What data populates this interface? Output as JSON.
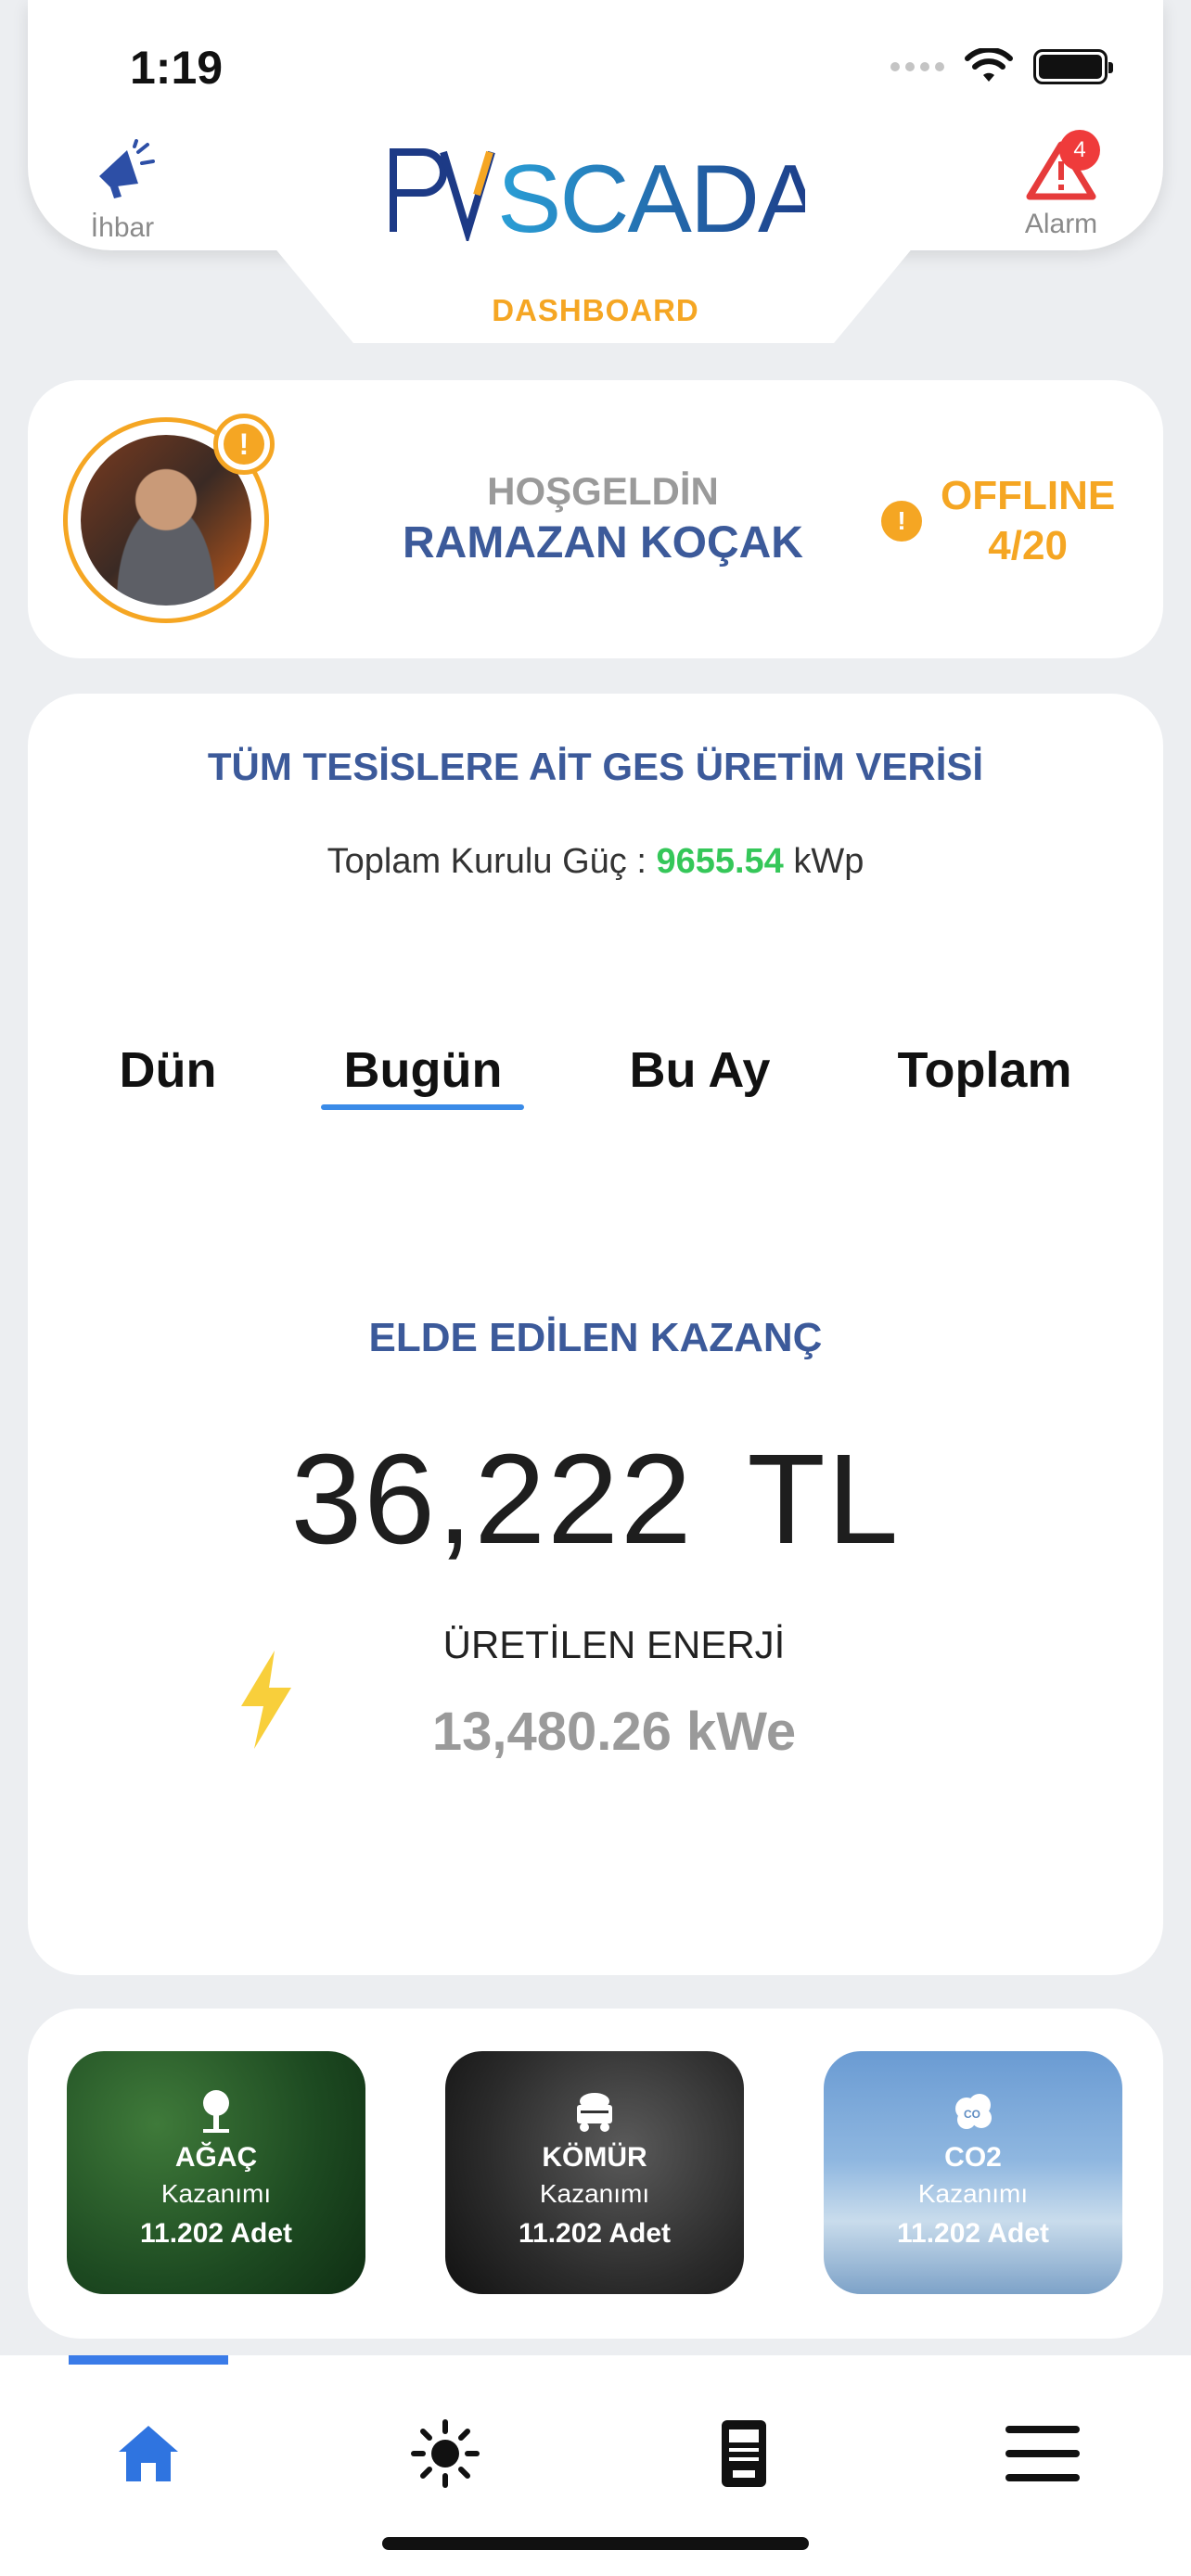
{
  "status": {
    "time": "1:19"
  },
  "header": {
    "ihbar_label": "İhbar",
    "alarm_label": "Alarm",
    "alarm_count": "4",
    "logo_text": "PVSCADA",
    "page_label": "DASHBOARD"
  },
  "welcome": {
    "greeting": "HOŞGELDİN",
    "name": "RAMAZAN KOÇAK",
    "offline_label": "OFFLINE",
    "offline_count": "4/20"
  },
  "production": {
    "title": "TÜM TESİSLERE AİT GES ÜRETİM VERİSİ",
    "capacity_label": "Toplam Kurulu Güç :",
    "capacity_value": "9655.54",
    "capacity_unit": "kWp",
    "tabs": [
      {
        "label": "Dün",
        "active": false
      },
      {
        "label": "Bugün",
        "active": true
      },
      {
        "label": "Bu Ay",
        "active": false
      },
      {
        "label": "Toplam",
        "active": false
      }
    ],
    "earnings_label": "ELDE EDİLEN KAZANÇ",
    "earnings_value": "36,222  TL",
    "energy_label": "ÜRETİLEN ENERJİ",
    "energy_value": "13,480.26 kWe"
  },
  "impact": [
    {
      "title": "AĞAÇ",
      "sub": "Kazanımı",
      "value": "11.202 Adet",
      "icon": "tree-icon"
    },
    {
      "title": "KÖMÜR",
      "sub": "Kazanımı",
      "value": "11.202 Adet",
      "icon": "coal-cart-icon"
    },
    {
      "title": "CO2",
      "sub": "Kazanımı",
      "value": "11.202 Adet",
      "icon": "co2-cloud-icon"
    }
  ],
  "nav": {
    "items": [
      "home-icon",
      "sun-icon",
      "meter-icon",
      "menu-icon"
    ],
    "active": "home-icon",
    "accent": "#3a7be8"
  },
  "colors": {
    "brand_blue": "#3c5a9a",
    "accent_orange": "#f5a623",
    "positive_green": "#35c759",
    "alert_red": "#ef3b3b"
  }
}
